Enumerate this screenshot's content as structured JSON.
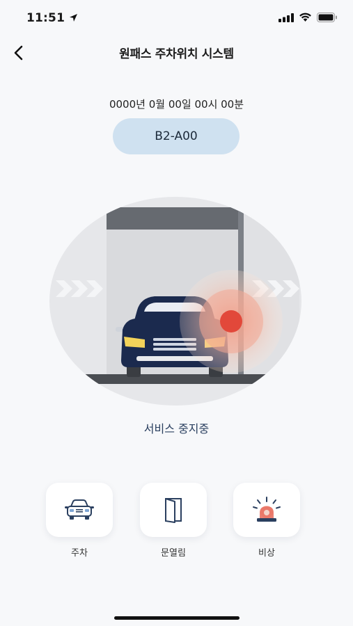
{
  "status_bar": {
    "time": "11:51"
  },
  "nav": {
    "title": "원패스 주차위치 시스템"
  },
  "datetime": "0000년 0월 00일 00시 00분",
  "location": "B2-A00",
  "service_status": "서비스 중지중",
  "actions": [
    {
      "label": "주차",
      "icon": "car-icon"
    },
    {
      "label": "문열림",
      "icon": "door-icon"
    },
    {
      "label": "비상",
      "icon": "emergency-siren-icon"
    }
  ],
  "colors": {
    "pill_bg": "#cfe1f0",
    "car_body": "#1b2a4e",
    "alert_red": "#e2483a",
    "headlight": "#f3d35a"
  }
}
